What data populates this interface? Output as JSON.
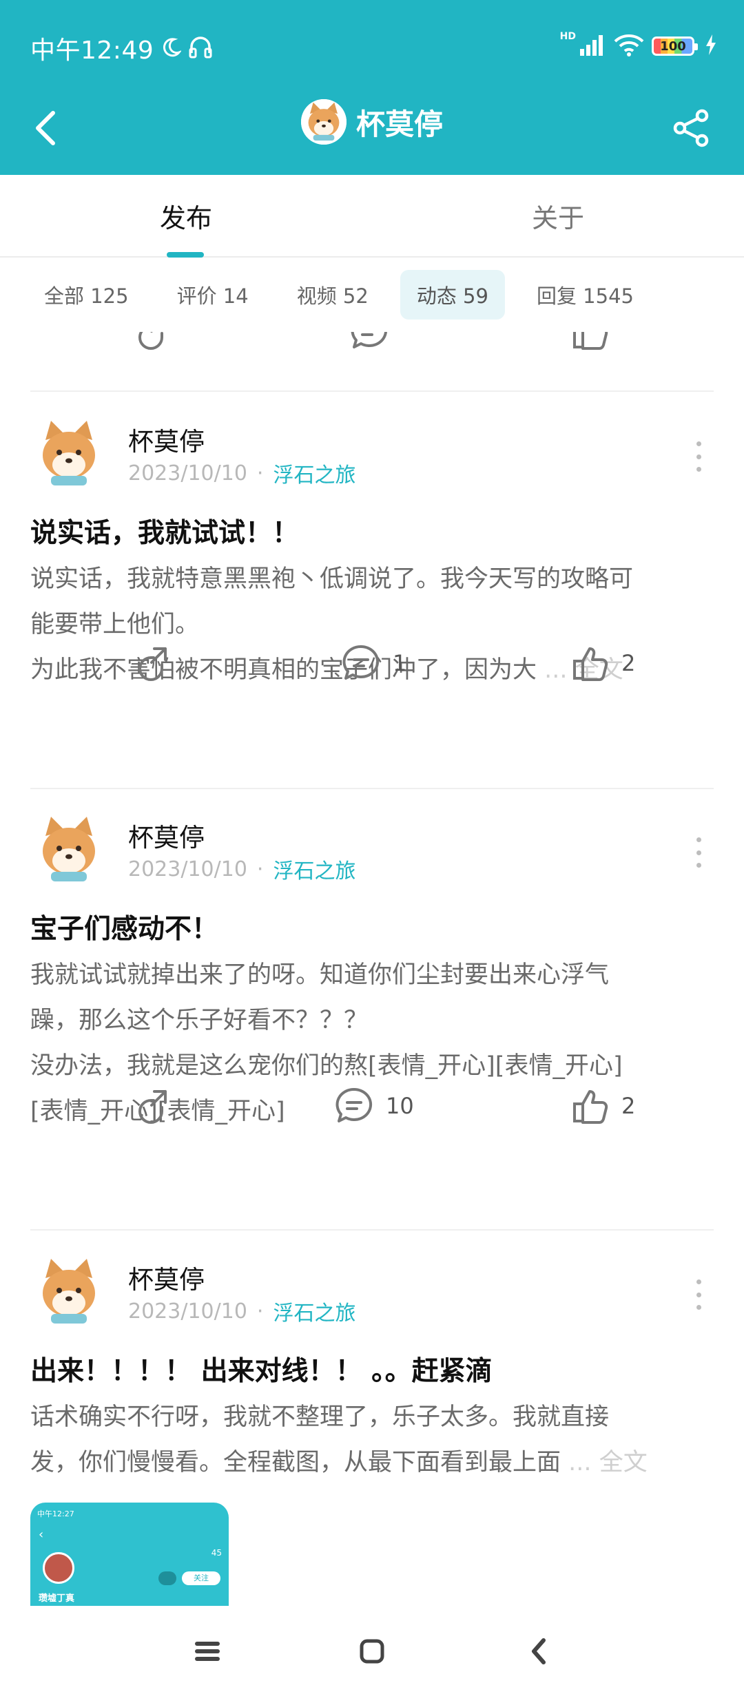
{
  "status_bar": {
    "time": "中午12:49",
    "hd": "HD",
    "battery": "100"
  },
  "header": {
    "title": "杯莫停"
  },
  "tabs": [
    {
      "label": "发布"
    },
    {
      "label": "关于"
    }
  ],
  "filters": [
    {
      "label": "全部 125"
    },
    {
      "label": "评价 14"
    },
    {
      "label": "视频 52"
    },
    {
      "label": "动态 59",
      "selected": true
    },
    {
      "label": "回复 1545"
    }
  ],
  "top_partial_actions": {
    "comments": "",
    "likes": ""
  },
  "posts": [
    {
      "author": "杯莫停",
      "date": "2023/10/10",
      "separator": "·",
      "topic": "浮石之旅",
      "title": "说实话，我就试试！！",
      "body_lines": [
        "说实话，我就特意黑黑袍丶低调说了。我今天写的攻略可",
        "能要带上他们。",
        " 为此我不害怕被不明真相的宝子们冲了，因为大"
      ],
      "ellipsis": "...",
      "more_link": "全文",
      "comments": "1",
      "likes": "2"
    },
    {
      "author": "杯莫停",
      "date": "2023/10/10",
      "separator": "·",
      "topic": "浮石之旅",
      "title": "宝子们感动不！",
      "body_lines": [
        "我就试试就掉出来了的呀。知道你们尘封要出来心浮气",
        "躁，那么这个乐子好看不？？？",
        " 没办法，我就是这么宠你们的熬[表情_开心][表情_开心]",
        "[表情_开心][表情_开心]"
      ],
      "comments": "10",
      "likes": "2"
    },
    {
      "author": "杯莫停",
      "date": "2023/10/10",
      "separator": "·",
      "topic": "浮石之旅",
      "title": "出来！！！！ 出来对线！！ 。。赶紧滴",
      "body_lines": [
        "话术确实不行呀，我就不整理了，乐子太多。我就直接",
        "发，你们慢慢看。全程截图，从最下面看到最上面"
      ],
      "ellipsis": "...",
      "more_link": "全文",
      "thumbnail": {
        "time": "中午12:27",
        "likes": "45",
        "follow": "关注",
        "name": "瓒墟丁真"
      }
    }
  ],
  "colors": {
    "accent": "#21b5c3",
    "muted": "#6a6a6a"
  }
}
